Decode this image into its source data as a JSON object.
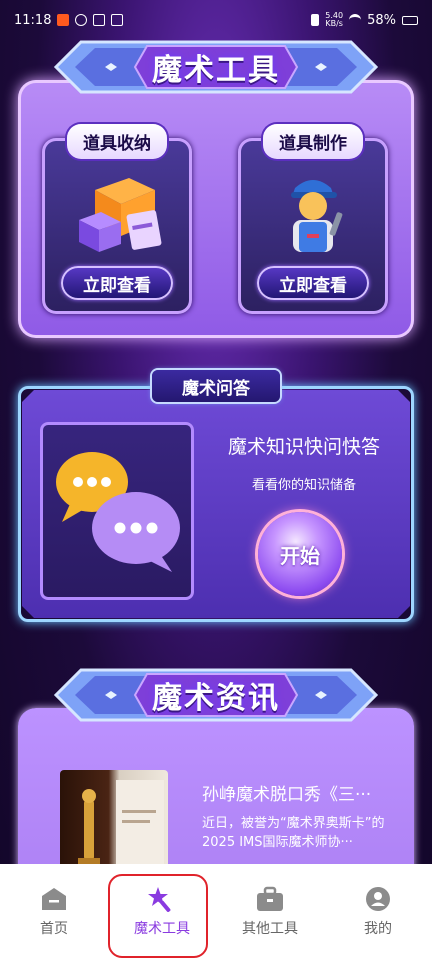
{
  "status_bar": {
    "time": "11:18",
    "net_speed_value": "5.40",
    "net_speed_unit": "KB/s",
    "battery": "58%"
  },
  "tools_section": {
    "title": "魔术工具",
    "cards": [
      {
        "label": "道具收纳",
        "button": "立即查看"
      },
      {
        "label": "道具制作",
        "button": "立即查看"
      }
    ]
  },
  "quiz_section": {
    "tag": "魔术问答",
    "title": "魔术知识快问快答",
    "subtitle": "看看你的知识储备",
    "start_button": "开始"
  },
  "news_section": {
    "title": "魔术资讯",
    "article": {
      "title": "孙峥魔术脱口秀《三···",
      "desc": "近日，被誉为“魔术界奥斯卡”的2025 IMS国际魔术师协···"
    }
  },
  "bottom_nav": {
    "items": [
      {
        "label": "首页",
        "icon": "home-icon"
      },
      {
        "label": "魔术工具",
        "icon": "magic-wand-icon",
        "active": true
      },
      {
        "label": "其他工具",
        "icon": "briefcase-icon"
      },
      {
        "label": "我的",
        "icon": "user-icon"
      }
    ]
  },
  "colors": {
    "active_nav": "#8a3be0",
    "inactive_nav": "#666666",
    "highlight_outline": "#e0232b"
  }
}
